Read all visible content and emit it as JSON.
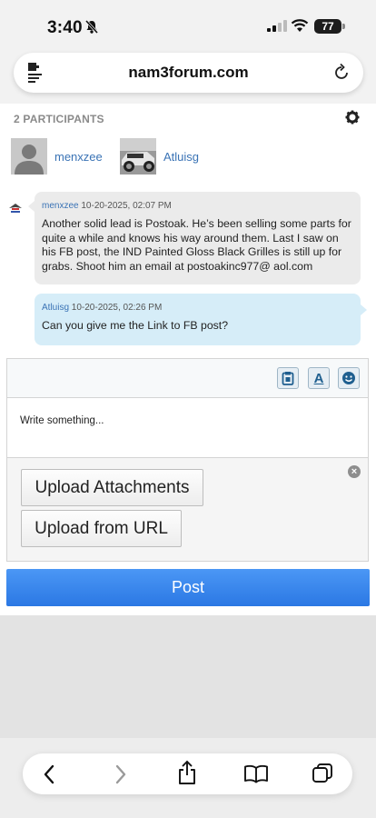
{
  "status": {
    "time": "3:40",
    "battery": "77"
  },
  "browser": {
    "url": "nam3forum.com"
  },
  "participants": {
    "heading": "2 PARTICIPANTS",
    "list": [
      {
        "name": "menxzee"
      },
      {
        "name": "Atluisg"
      }
    ]
  },
  "messages": [
    {
      "author": "menxzee",
      "timestamp": "10-20-2025, 02:07 PM",
      "text": "Another solid lead is Postoak. He’s been selling some parts for quite a while and knows his way around them. Last I saw on his FB post, the IND Painted Gloss Black Grilles is still up for grabs. Shoot him an email at postoakinc977@ aol.com"
    },
    {
      "author": "Atluisg",
      "timestamp": "10-20-2025, 02:26 PM",
      "text": "Can you give me the Link to FB post?"
    }
  ],
  "editor": {
    "placeholder": "Write something...",
    "upload_attachments": "Upload Attachments",
    "upload_url": "Upload from URL",
    "close_symbol": "×",
    "format_letter": "A"
  },
  "post_button": "Post",
  "colors": {
    "link": "#3a73b5",
    "post_button": "#2b78e4",
    "reply_bubble": "#d6edf8"
  }
}
